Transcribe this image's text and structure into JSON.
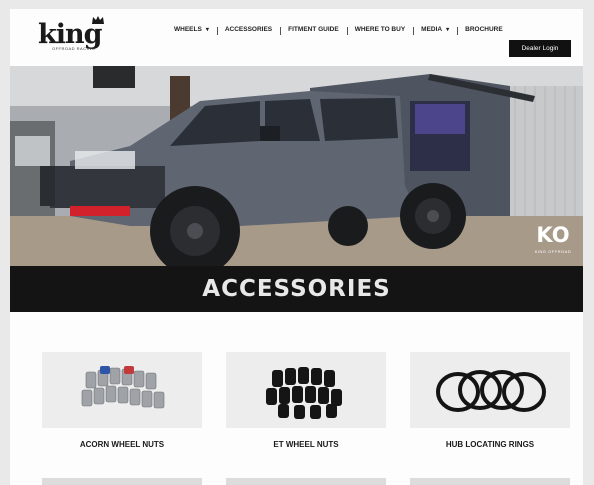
{
  "header": {
    "logo_text": "king",
    "logo_tagline": "OFFROAD RACING",
    "dealer_login": "Dealer Login"
  },
  "nav": {
    "items": [
      {
        "label": "WHEELS",
        "dropdown": true
      },
      {
        "label": "ACCESSORIES",
        "dropdown": false
      },
      {
        "label": "FITMENT GUIDE",
        "dropdown": false
      },
      {
        "label": "WHERE TO BUY",
        "dropdown": false
      },
      {
        "label": "MEDIA",
        "dropdown": true
      },
      {
        "label": "BROCHURE",
        "dropdown": false
      }
    ],
    "caret": "▾"
  },
  "hero": {
    "banner_title": "ACCESSORIES",
    "badge_text": "KO",
    "badge_subtext": "KING OFFROAD"
  },
  "products": [
    {
      "name": "ACORN WHEEL NUTS",
      "image": "acorn-wheel-nuts-image"
    },
    {
      "name": "ET WHEEL NUTS",
      "image": "et-wheel-nuts-image"
    },
    {
      "name": "HUB LOCATING RINGS",
      "image": "hub-locating-rings-image"
    }
  ],
  "colors": {
    "background": "#e9e9e9",
    "page": "#fdfdfd",
    "button": "#111111",
    "banner": "#141414",
    "truck": "#5f6571",
    "accent_red": "#d3212b"
  }
}
